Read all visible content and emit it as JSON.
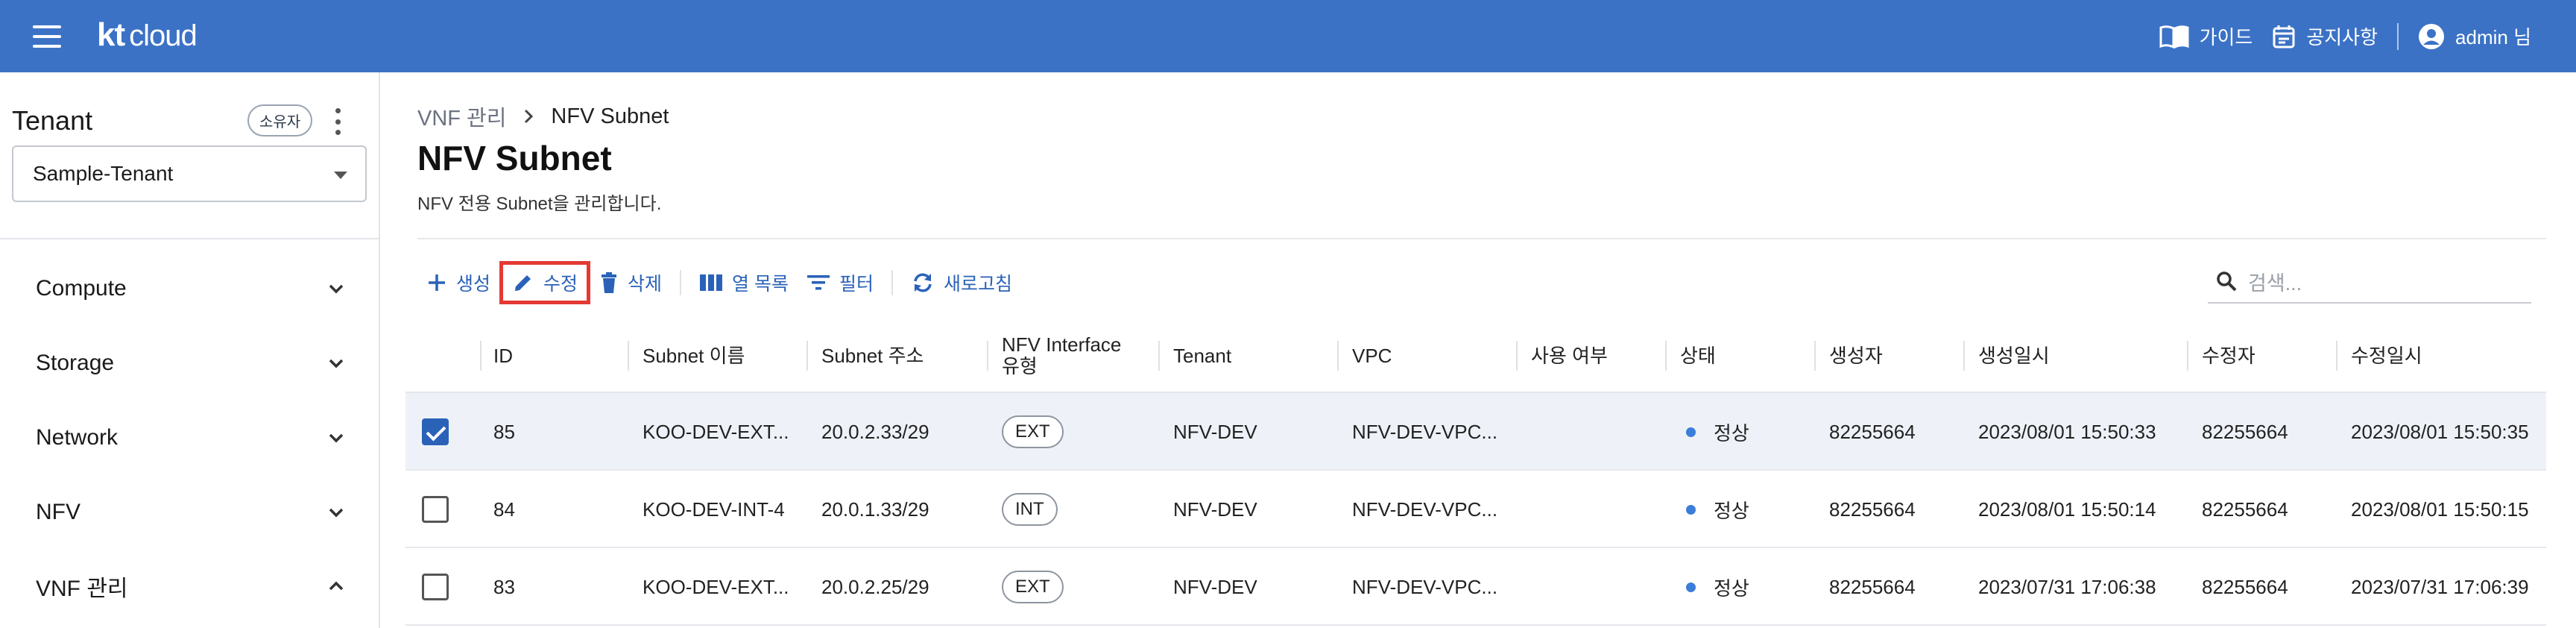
{
  "topbar": {
    "logo_kt": "kt",
    "logo_cloud": "cloud",
    "links": {
      "guide": "가이드",
      "notice": "공지사항",
      "user": "admin 님"
    }
  },
  "sidebar": {
    "tenant_title": "Tenant",
    "owner_badge": "소유자",
    "tenant_selected": "Sample-Tenant",
    "items": [
      {
        "label": "Compute",
        "state": "collapsed"
      },
      {
        "label": "Storage",
        "state": "collapsed"
      },
      {
        "label": "Network",
        "state": "collapsed"
      },
      {
        "label": "NFV",
        "state": "collapsed"
      },
      {
        "label": "VNF 관리",
        "state": "expanded"
      }
    ]
  },
  "breadcrumb": {
    "parent": "VNF 관리",
    "current": "NFV Subnet"
  },
  "page": {
    "title": "NFV Subnet",
    "description": "NFV 전용 Subnet을 관리합니다."
  },
  "toolbar": {
    "create": "생성",
    "edit": "수정",
    "delete": "삭제",
    "columns": "열 목록",
    "filter": "필터",
    "refresh": "새로고침"
  },
  "search": {
    "placeholder": "검색..."
  },
  "table": {
    "headers": {
      "id": "ID",
      "subnet_name": "Subnet 이름",
      "subnet_addr": "Subnet 주소",
      "nfv_if_type_1": "NFV Interface",
      "nfv_if_type_2": "유형",
      "tenant": "Tenant",
      "vpc": "VPC",
      "in_use": "사용 여부",
      "status": "상태",
      "creator": "생성자",
      "created_at": "생성일시",
      "modifier": "수정자",
      "modified_at": "수정일시"
    },
    "rows": [
      {
        "checked": true,
        "id": "85",
        "name": "KOO-DEV-EXT...",
        "addr": "20.0.2.33/29",
        "type": "EXT",
        "tenant": "NFV-DEV",
        "vpc": "NFV-DEV-VPC...",
        "in_use": "",
        "status": "정상",
        "creator": "82255664",
        "created_at": "2023/08/01 15:50:33",
        "modifier": "82255664",
        "modified_at": "2023/08/01 15:50:35"
      },
      {
        "checked": false,
        "id": "84",
        "name": "KOO-DEV-INT-4",
        "addr": "20.0.1.33/29",
        "type": "INT",
        "tenant": "NFV-DEV",
        "vpc": "NFV-DEV-VPC...",
        "in_use": "",
        "status": "정상",
        "creator": "82255664",
        "created_at": "2023/08/01 15:50:14",
        "modifier": "82255664",
        "modified_at": "2023/08/01 15:50:15"
      },
      {
        "checked": false,
        "id": "83",
        "name": "KOO-DEV-EXT...",
        "addr": "20.0.2.25/29",
        "type": "EXT",
        "tenant": "NFV-DEV",
        "vpc": "NFV-DEV-VPC...",
        "in_use": "",
        "status": "정상",
        "creator": "82255664",
        "created_at": "2023/07/31 17:06:38",
        "modifier": "82255664",
        "modified_at": "2023/07/31 17:06:39"
      }
    ]
  },
  "colors": {
    "topbar": "#3b72c6",
    "accent": "#2a62b8",
    "highlight_border": "#e53935",
    "status_dot": "#3b7dd8",
    "selected_row": "#eef2f8"
  }
}
